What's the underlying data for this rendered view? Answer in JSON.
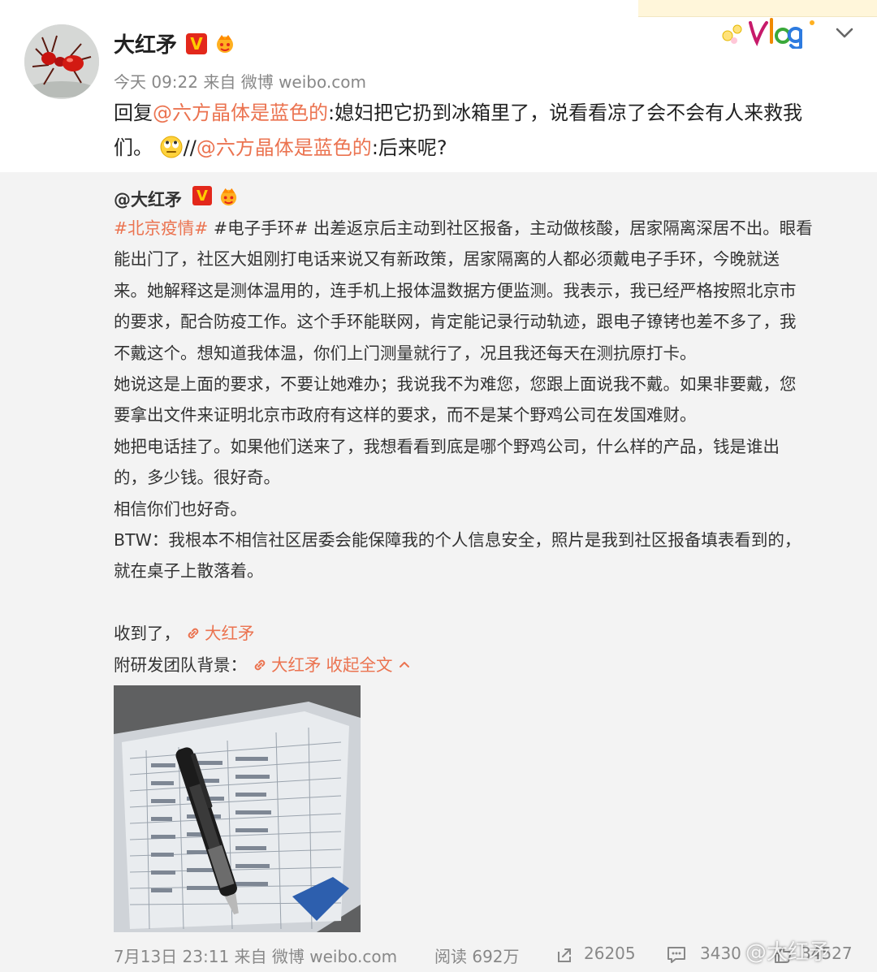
{
  "post": {
    "username": "大红矛",
    "verified_badge": "V",
    "meta": "今天 09:22 来自 微博 weibo.com",
    "reply_prefix": "回复",
    "reply_mention_1": "@六方晶体是蓝色的",
    "reply_text_1": ":媳妇把它扔到冰箱里了，说看看凉了会不会有人来救我",
    "reply_text_2": "们。",
    "reply_sep": "//",
    "reply_mention_2": "@六方晶体是蓝色的",
    "reply_text_3": ":后来呢?",
    "icons": {
      "avatar": "red-ant-avatar",
      "sticker": "vlog-sticker",
      "more": "chevron-down-icon"
    }
  },
  "repost": {
    "username": "@大红矛",
    "verified_badge": "V",
    "hashtag_1": "#北京疫情#",
    "hashtag_2": "#电子手环#",
    "lines": [
      "出差返京后主动到社区报备，主动做核酸，居家隔离深居不出。眼看",
      "能出门了，社区大姐刚打电话来说又有新政策，居家隔离的人都必须戴电子手环，今晚就送",
      "来。她解释这是测体温用的，连手机上报体温数据方便监测。我表示，我已经严格按照北京市",
      "的要求，配合防疫工作。这个手环能联网，肯定能记录行动轨迹，跟电子镣铐也差不多了，我",
      "不戴这个。想知道我体温，你们上门测量就行了，况且我还每天在测抗原打卡。",
      "她说这是上面的要求，不要让她难办；我说我不为难您，您跟上面说我不戴。如果非要戴，您",
      "要拿出文件来证明北京市政府有这样的要求，而不是某个野鸡公司在发国难财。",
      "她把电话挂了。如果他们送来了，我想看看到底是哪个野鸡公司，什么样的产品，钱是谁出",
      "的，多少钱。很好奇。",
      "相信你们也好奇。",
      "BTW：我根本不相信社区居委会能保障我的个人信息安全，照片是我到社区报备填表看到的，",
      "就在桌子上散落着。"
    ],
    "received_text": "收到了，",
    "received_link": "大红矛",
    "team_text": "附研发团队背景：",
    "team_link": "大红矛",
    "collapse_label": "收起全文",
    "photo_icon": "photo-form-with-pen",
    "footer": {
      "time": "7月13日 23:11 来自 微博 weibo.com",
      "reads": "阅读 692万",
      "reposts": "26205",
      "comments": "3430",
      "likes": "34527"
    }
  },
  "watermark": "@大红矛",
  "colors": {
    "accent": "#eb7350",
    "badge_red": "#e3281b",
    "repost_bg": "#f3f3f3",
    "meta_gray": "#888888"
  }
}
